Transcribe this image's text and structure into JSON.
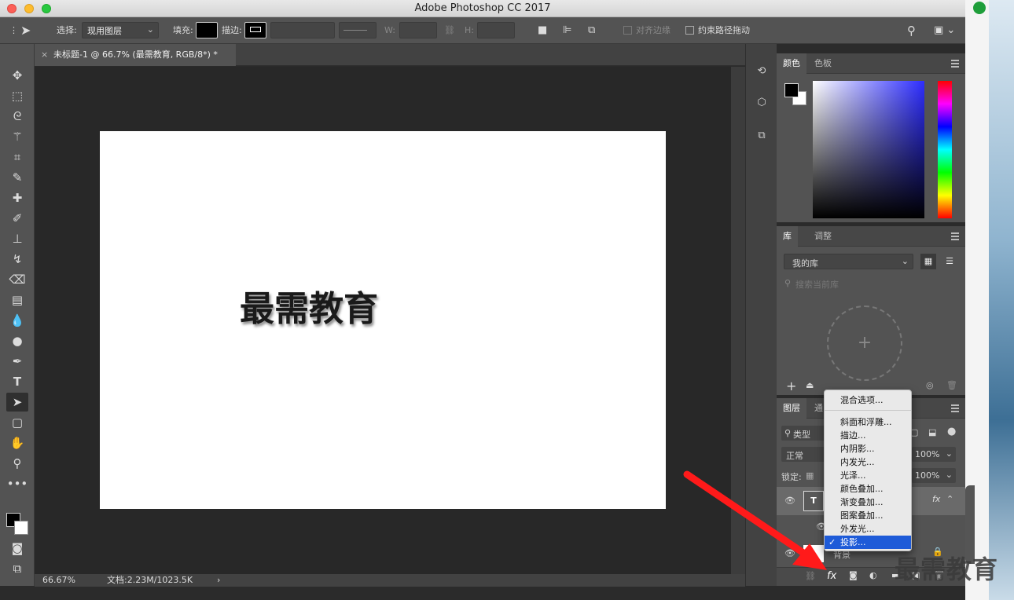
{
  "window": {
    "title": "Adobe Photoshop CC 2017"
  },
  "options_bar": {
    "select_label": "选择:",
    "select_value": "现用图层",
    "fill_label": "填充:",
    "stroke_label": "描边:",
    "w_label": "W:",
    "h_label": "H:",
    "align_edges_label": "对齐边缘",
    "constrain_path_label": "约束路径拖动"
  },
  "document_tab": {
    "label": "未标题-1 @ 66.7% (最需教育, RGB/8*) *"
  },
  "canvas": {
    "text": "最需教育"
  },
  "status_bar": {
    "zoom": "66.67%",
    "doc_info": "文档:2.23M/1023.5K"
  },
  "color_panel": {
    "tabs": [
      "颜色",
      "色板"
    ]
  },
  "library_panel": {
    "tabs": [
      "库",
      "调整"
    ],
    "library_select": "我的库",
    "search_placeholder": "搜索当前库"
  },
  "layers_panel": {
    "tabs": [
      "图层",
      "通"
    ],
    "filter_label": "类型",
    "blend_mode": "正常",
    "opacity": "100%",
    "lock_label": "锁定:",
    "fill": "100%",
    "background_layer": "背景"
  },
  "fx_menu": {
    "items": [
      {
        "label": "混合选项..."
      },
      {
        "label": "斜面和浮雕..."
      },
      {
        "label": "描边..."
      },
      {
        "label": "内阴影..."
      },
      {
        "label": "内发光..."
      },
      {
        "label": "光泽..."
      },
      {
        "label": "颜色叠加..."
      },
      {
        "label": "渐变叠加..."
      },
      {
        "label": "图案叠加..."
      },
      {
        "label": "外发光..."
      },
      {
        "label": "投影...",
        "checked": true
      }
    ]
  },
  "watermark": "最需教育",
  "colors": {
    "accent": "#1e5bd8",
    "arrow": "#ff1a1a",
    "panel": "#535353"
  }
}
